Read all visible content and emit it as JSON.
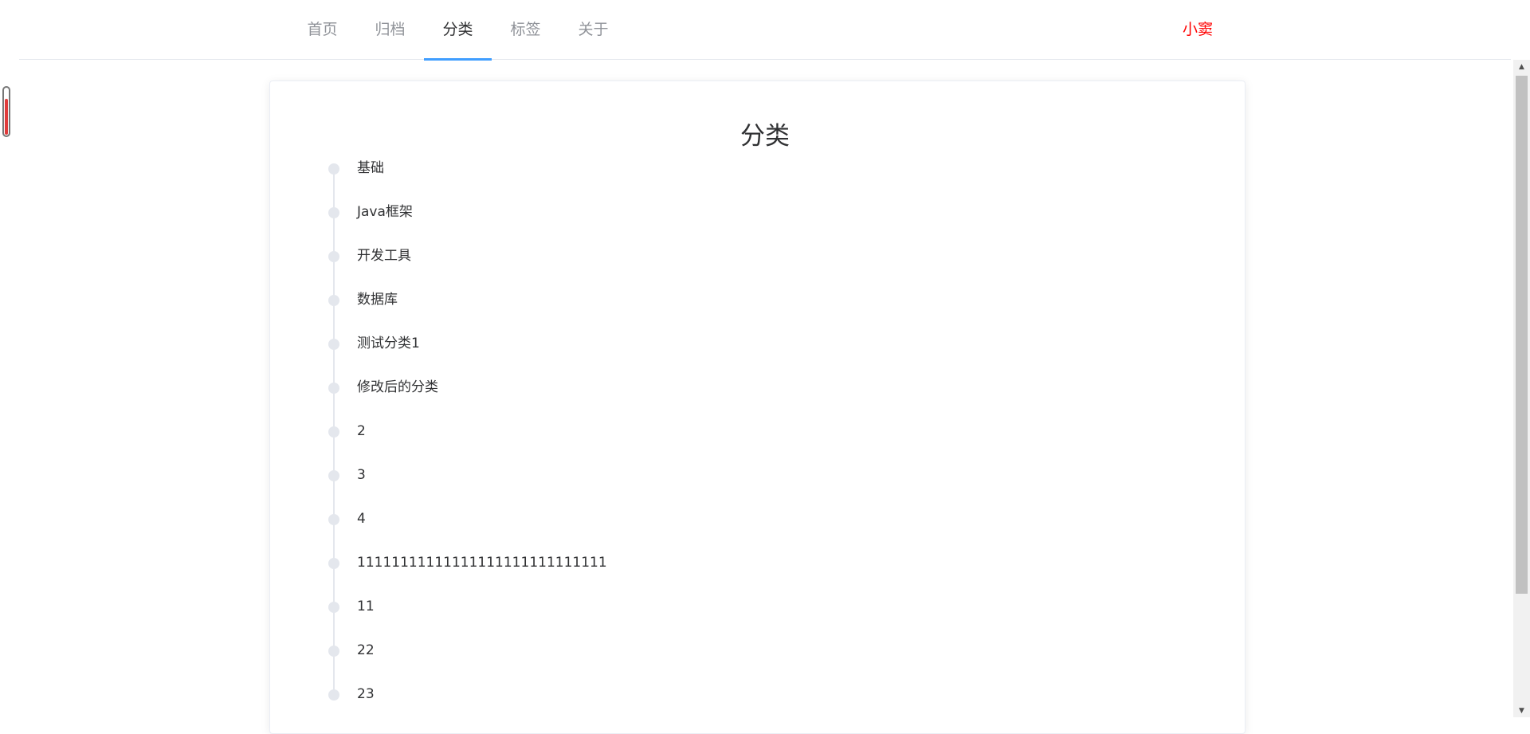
{
  "nav": {
    "tabs": [
      {
        "label": "首页",
        "active": false
      },
      {
        "label": "归档",
        "active": false
      },
      {
        "label": "分类",
        "active": true
      },
      {
        "label": "标签",
        "active": false
      },
      {
        "label": "关于",
        "active": false
      }
    ],
    "user_name": "小窦"
  },
  "page": {
    "title": "分类"
  },
  "categories": [
    "基础",
    "Java框架",
    "开发工具",
    "数据库",
    "测试分类1",
    "修改后的分类",
    "2",
    "3",
    "4",
    "11111111111111111111111111111",
    "11",
    "22",
    "23"
  ],
  "widgets": {
    "thermometer_fill_fraction": 0.75
  },
  "colors": {
    "accent": "#409eff",
    "user_name": "#ff0000",
    "tab_inactive": "#909399",
    "tab_active": "#303133",
    "timeline_node": "#e4e7ed",
    "thermometer": "#e03c3c"
  },
  "icons": {
    "scroll_up": "triangle-up-icon",
    "scroll_down": "triangle-down-icon",
    "timeline_node": "circle-dot-icon"
  }
}
